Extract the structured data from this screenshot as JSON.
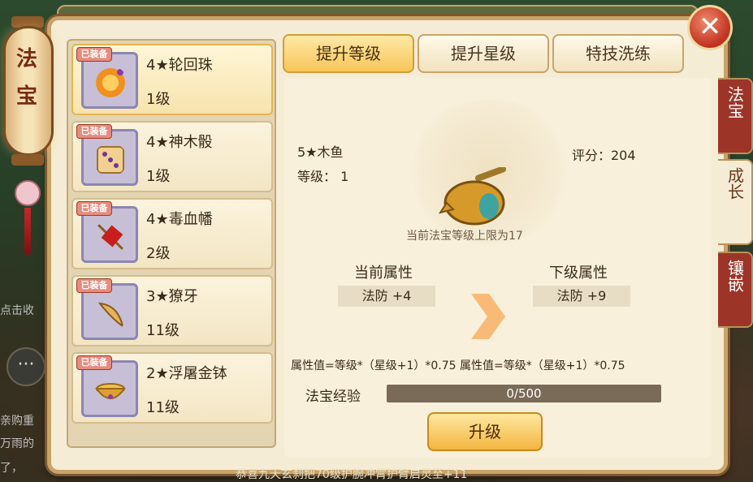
{
  "background": {
    "left_texts": [
      "点击收",
      "亲购重",
      "万雨的",
      "了，"
    ],
    "chat_icon": "chat-bubble-icon",
    "ticker": "恭喜九天玄刹把70级护腕冲霄护臂启灵至+11"
  },
  "lantern": {
    "label": "法宝"
  },
  "items": [
    {
      "badge": "已装备",
      "name": "4★轮回珠",
      "level": "1级",
      "icon": "orb-icon",
      "color": "#e05a20",
      "selected": true
    },
    {
      "badge": "已装备",
      "name": "4★神木骰",
      "level": "1级",
      "icon": "dice-icon",
      "color": "#e6b860",
      "selected": false
    },
    {
      "badge": "已装备",
      "name": "4★毒血幡",
      "level": "2级",
      "icon": "banner-icon",
      "color": "#c81e1e",
      "selected": false
    },
    {
      "badge": "已装备",
      "name": "3★獠牙",
      "level": "11级",
      "icon": "fang-icon",
      "color": "#d9a04a",
      "selected": false
    },
    {
      "badge": "已装备",
      "name": "2★浮屠金钵",
      "level": "11级",
      "icon": "bowl-icon",
      "color": "#e0b040",
      "selected": false
    }
  ],
  "tabs": [
    {
      "label": "提升等级",
      "active": true
    },
    {
      "label": "提升星级",
      "active": false
    },
    {
      "label": "特技洗练",
      "active": false
    }
  ],
  "side_tabs": [
    "法宝",
    "成长",
    "镶嵌"
  ],
  "detail": {
    "name": "5★木鱼",
    "level_text": "等级： 1",
    "score_text": "评分：204",
    "limit_text": "当前法宝等级上限为17",
    "current_attr_title": "当前属性",
    "current_attr_value": "法防 +4",
    "next_attr_title": "下级属性",
    "next_attr_value": "法防 +9",
    "formula": "属性值=等级*（星级+1）*0.75 属性值=等级*（星级+1）*0.75",
    "exp_label": "法宝经验",
    "exp_text": "0/500",
    "exp_fraction": 0,
    "upgrade_label": "升级"
  },
  "close_label": "✕",
  "colors": {
    "accent": "#f7c659",
    "panel": "#f5ecd5",
    "badge": "#e88a7c"
  }
}
